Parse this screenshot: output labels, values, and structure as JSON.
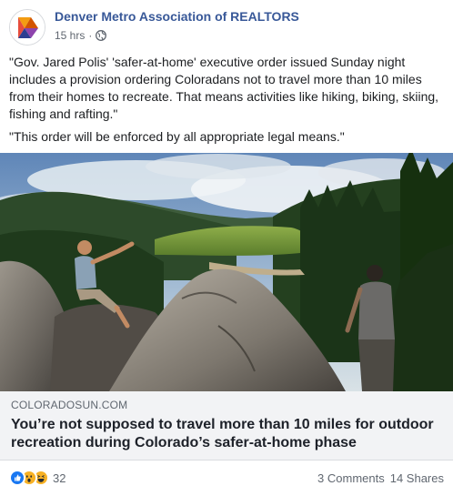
{
  "page": {
    "name": "Denver Metro Association of REALTORS",
    "time": "15 hrs",
    "separator": "·"
  },
  "post": {
    "paragraph_1": "\"Gov. Jared Polis' 'safer-at-home' executive order issued Sunday night includes a provision ordering Coloradans not to travel more than 10 miles from their homes to recreate. That means activities like hiking, biking, skiing, fishing and rafting.\"",
    "paragraph_2": "\"This order will be enforced by all appropriate legal means.\""
  },
  "link": {
    "domain": "COLORADOSUN.COM",
    "headline": "You’re not supposed to travel more than 10 miles for outdoor recreation during Colorado’s safer-at-home phase"
  },
  "footer": {
    "reaction_count": "32",
    "comments": "3 Comments",
    "shares": "14 Shares",
    "reactions": [
      "like-icon",
      "wow-icon",
      "haha-icon"
    ]
  },
  "colors": {
    "page_name": "#385898",
    "link_bg": "#f2f3f5",
    "like_blue": "#1877f2",
    "emoji_yellow": "#f7b125"
  }
}
